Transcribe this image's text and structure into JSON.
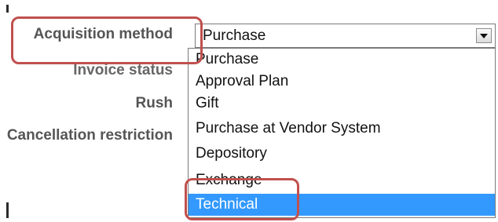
{
  "form": {
    "labels": {
      "acquisition_method": "Acquisition method",
      "invoice_status": "Invoice status",
      "rush": "Rush",
      "cancellation_restriction": "Cancellation restriction"
    },
    "acquisition_select": {
      "value": "Purchase",
      "options": [
        "Purchase",
        "Approval Plan",
        "Gift",
        "Purchase at Vendor System",
        "Depository",
        "Exchange",
        "Technical"
      ],
      "highlighted_option": "Technical"
    }
  },
  "icons": {
    "dropdown_arrow": "chevron-down-icon"
  },
  "colors": {
    "highlight": "#3399ff",
    "callout": "#c0504d",
    "label_text": "#555555"
  }
}
